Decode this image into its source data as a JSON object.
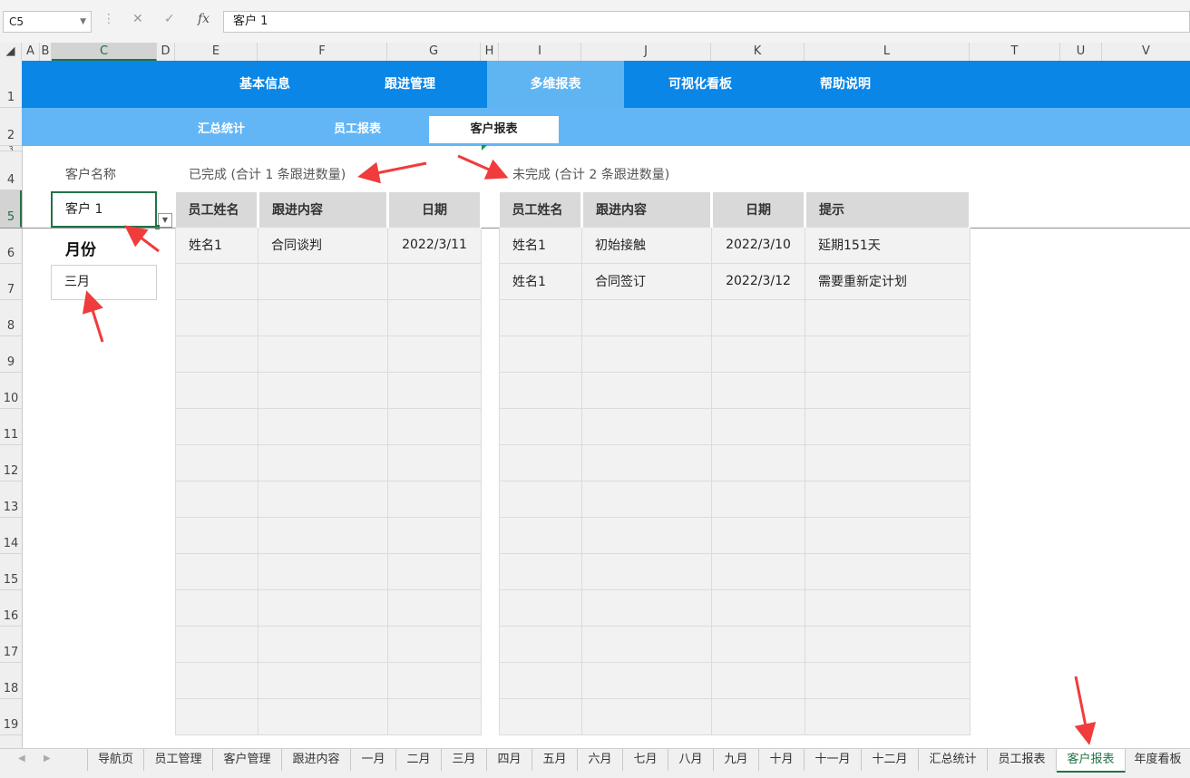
{
  "formula_bar": {
    "name_box": "C5",
    "cancel_icon": "✕",
    "enter_icon": "✓",
    "fx_icon": "fx",
    "formula": "客户 1"
  },
  "columns": [
    "A",
    "B",
    "C",
    "D",
    "E",
    "F",
    "G",
    "H",
    "I",
    "J",
    "K",
    "L",
    "T",
    "U",
    "V"
  ],
  "rows": [
    "1",
    "2",
    "3",
    "4",
    "5",
    "6",
    "7",
    "8",
    "9",
    "10",
    "11",
    "12",
    "13",
    "14",
    "15",
    "16",
    "17",
    "18",
    "19"
  ],
  "nav_main": [
    "基本信息",
    "跟进管理",
    "多维报表",
    "可视化看板",
    "帮助说明"
  ],
  "nav_sub": [
    "汇总统计",
    "员工报表",
    "客户报表"
  ],
  "filters": {
    "customer_label": "客户名称",
    "customer_value": "客户 1",
    "month_label": "月份",
    "month_value": "三月"
  },
  "completed": {
    "title": "已完成 (合计 1 条跟进数量)",
    "headers": [
      "员工姓名",
      "跟进内容",
      "日期"
    ],
    "rows": [
      [
        "姓名1",
        "合同谈判",
        "2022/3/11"
      ]
    ]
  },
  "uncompleted": {
    "title": "未完成 (合计 2 条跟进数量)",
    "headers": [
      "员工姓名",
      "跟进内容",
      "日期",
      "提示"
    ],
    "rows": [
      [
        "姓名1",
        "初始接触",
        "2022/3/10",
        "延期151天"
      ],
      [
        "姓名1",
        "合同签订",
        "2022/3/12",
        "需要重新定计划"
      ]
    ]
  },
  "sheet_tabs": [
    "导航页",
    "员工管理",
    "客户管理",
    "跟进内容",
    "一月",
    "二月",
    "三月",
    "四月",
    "五月",
    "六月",
    "七月",
    "八月",
    "九月",
    "十月",
    "十一月",
    "十二月",
    "汇总统计",
    "员工报表",
    "客户报表",
    "年度看板"
  ],
  "active_tab": "客户报表",
  "colors": {
    "nav_main": "#0a86e6",
    "nav_sub": "#63b6f5",
    "selection": "#217346",
    "annotation_arrow": "#f03c3c"
  }
}
